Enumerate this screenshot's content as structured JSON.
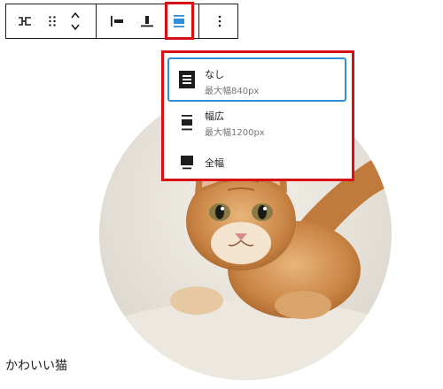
{
  "toolbar": {
    "icons": [
      "transform-icon",
      "drag-handle-icon",
      "move-up-down-icon",
      "align-left-icon",
      "align-bottom-icon",
      "align-wide-icon",
      "more-options-icon"
    ],
    "selected_icon": "align-wide-icon",
    "accent_color": "#2f8ed8",
    "highlight_color": "#d90f16"
  },
  "width_menu": {
    "items": [
      {
        "label": "なし",
        "sub": "最大幅840px",
        "icon": "no-width-icon",
        "selected": true
      },
      {
        "label": "幅広",
        "sub": "最大幅1200px",
        "icon": "wide-width-icon",
        "selected": false
      },
      {
        "label": "全幅",
        "sub": "",
        "icon": "full-width-icon",
        "selected": false
      }
    ]
  },
  "image": {
    "subject": "kitten-photo"
  },
  "caption": "かわいい猫"
}
